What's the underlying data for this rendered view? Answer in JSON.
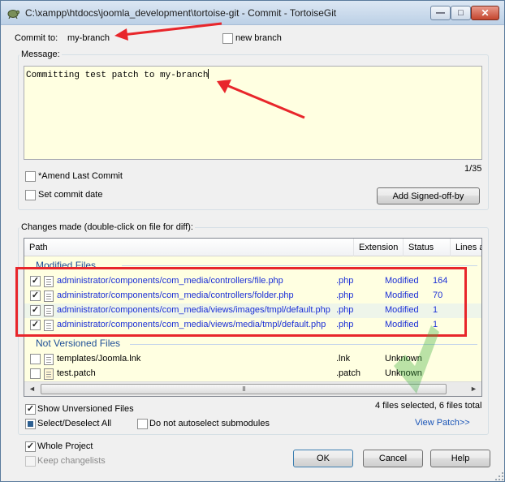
{
  "window": {
    "title": "C:\\xampp\\htdocs\\joomla_development\\tortoise-git - Commit - TortoiseGit",
    "buttons": {
      "minimize": "—",
      "maximize": "□",
      "close": "✕"
    }
  },
  "commit_to": {
    "label": "Commit to:",
    "branch": "my-branch"
  },
  "new_branch": {
    "label": "new branch",
    "checked": false
  },
  "message": {
    "group_label": "Message:",
    "text": "Committing test patch to my-branch",
    "counter": "1/35"
  },
  "amend": {
    "label": "*Amend Last Commit",
    "checked": false
  },
  "set_commit_date": {
    "label": "Set commit date",
    "checked": false
  },
  "add_signed_off_button": "Add Signed-off-by",
  "changes": {
    "group_label": "Changes made (double-click on file for diff):",
    "columns": [
      "Path",
      "Extension",
      "Status",
      "Lines added"
    ],
    "modified_group": "Modified Files",
    "not_versioned_group": "Not Versioned Files",
    "modified_rows": [
      {
        "path": "administrator/components/com_media/controllers/file.php",
        "ext": ".php",
        "status": "Modified",
        "lines": "164",
        "checked": true
      },
      {
        "path": "administrator/components/com_media/controllers/folder.php",
        "ext": ".php",
        "status": "Modified",
        "lines": "70",
        "checked": true
      },
      {
        "path": "administrator/components/com_media/views/images/tmpl/default.php",
        "ext": ".php",
        "status": "Modified",
        "lines": "1",
        "checked": true
      },
      {
        "path": "administrator/components/com_media/views/media/tmpl/default.php",
        "ext": ".php",
        "status": "Modified",
        "lines": "1",
        "checked": true
      }
    ],
    "unversioned_rows": [
      {
        "path": "templates/Joomla.lnk",
        "ext": ".lnk",
        "status": "Unknown",
        "lines": "",
        "checked": false
      },
      {
        "path": "test.patch",
        "ext": ".patch",
        "status": "Unknown",
        "lines": "",
        "checked": false
      }
    ],
    "scrollbar": {
      "left": "◄",
      "right": "►",
      "grip": "III"
    },
    "summary": "4 files selected, 6 files total"
  },
  "show_unversioned": {
    "label": "Show Unversioned Files",
    "checked": true
  },
  "select_all": {
    "label": "Select/Deselect All",
    "state": "partial"
  },
  "no_autoselect": {
    "label": "Do not autoselect submodules",
    "checked": false
  },
  "view_patch_link": "View Patch>>",
  "whole_project": {
    "label": "Whole Project",
    "checked": true
  },
  "keep_changelists": {
    "label": "Keep changelists",
    "checked": false
  },
  "buttons": {
    "ok": "OK",
    "cancel": "Cancel",
    "help": "Help"
  },
  "colors": {
    "accent_link": "#1a55b7",
    "file_link": "#1b2fd6",
    "list_background": "#ffffe1",
    "annotation_red": "#e8262b"
  }
}
